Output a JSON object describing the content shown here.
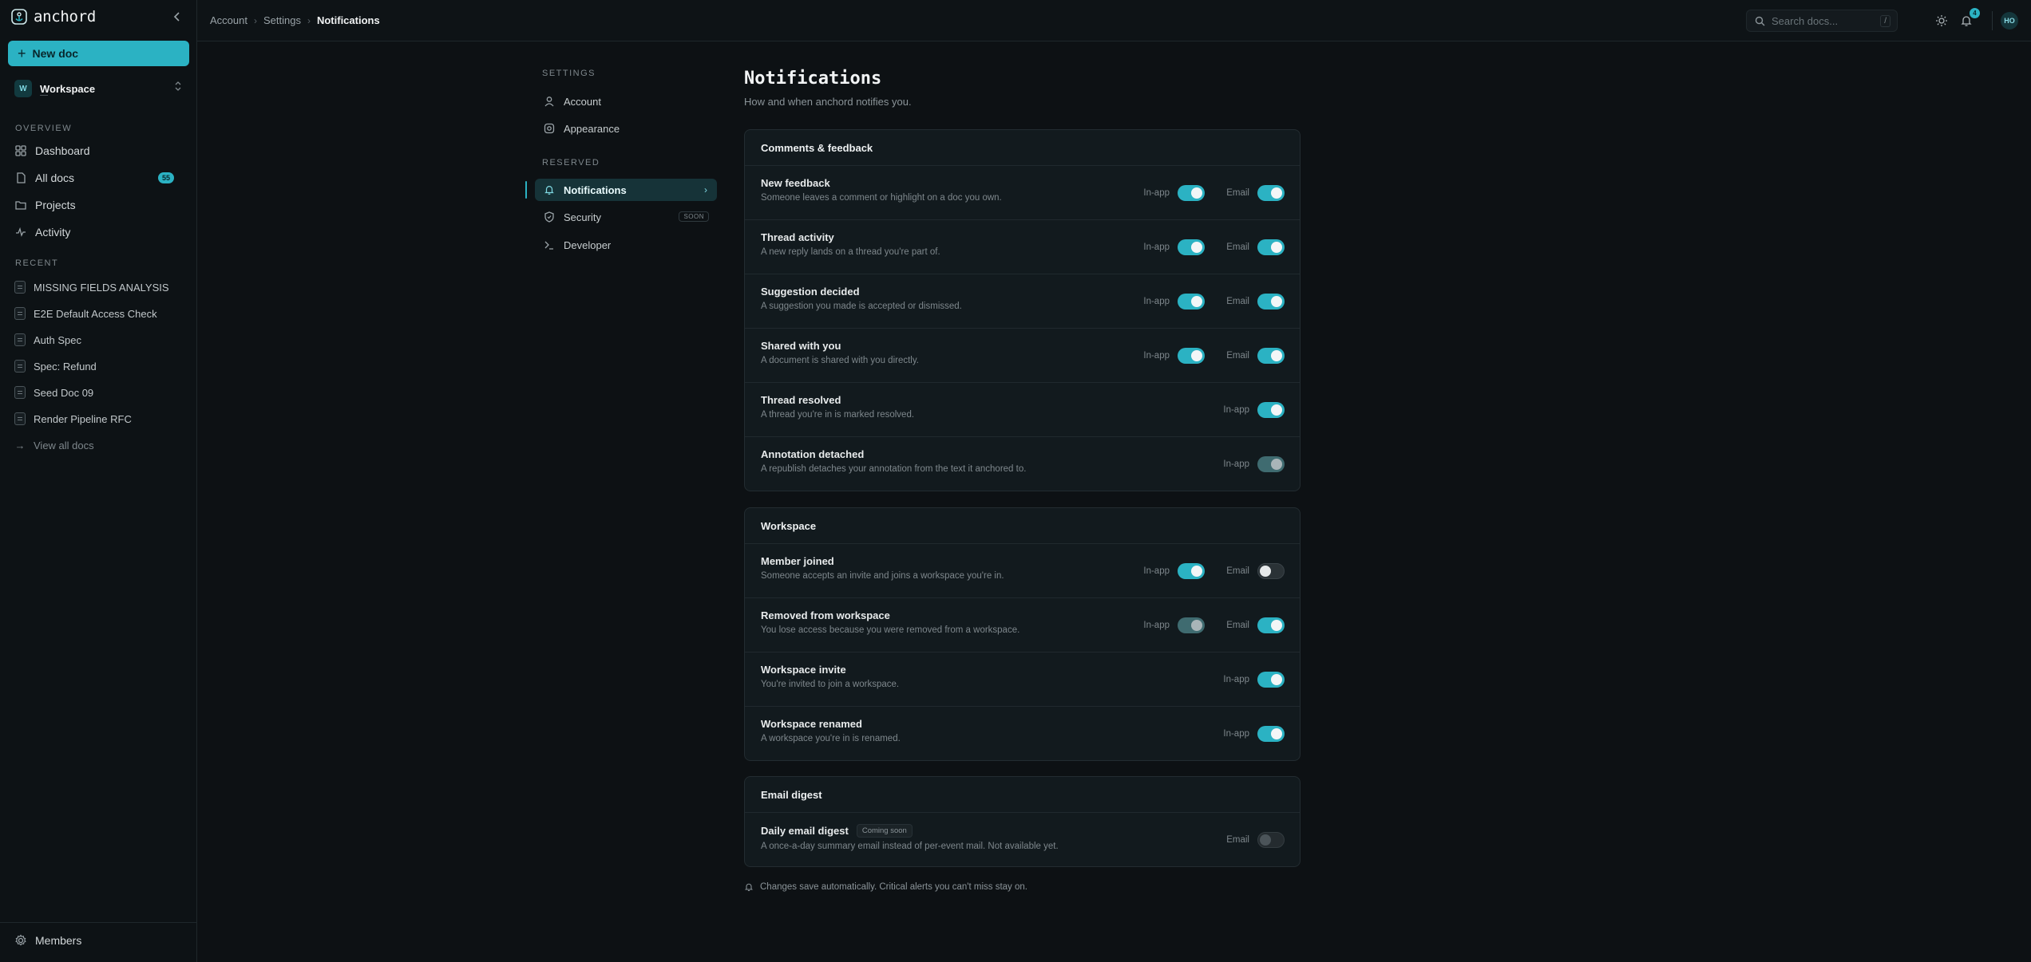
{
  "sidebar": {
    "brand": "anchord",
    "new_doc_label": "New doc",
    "workspace": {
      "initial": "W",
      "name": "Workspace",
      "sub": "—"
    },
    "overview_label": "OVERVIEW",
    "nav": [
      {
        "label": "Dashboard",
        "icon": "grid-icon"
      },
      {
        "label": "All docs",
        "icon": "file-icon",
        "count": "55"
      },
      {
        "label": "Projects",
        "icon": "folder-icon"
      },
      {
        "label": "Activity",
        "icon": "activity-icon"
      }
    ],
    "recent_label": "RECENT",
    "recent": [
      {
        "label": "MISSING FIELDS ANALYSIS"
      },
      {
        "label": "E2E Default Access Check"
      },
      {
        "label": "Auth Spec"
      },
      {
        "label": "Spec: Refund"
      },
      {
        "label": "Seed Doc 09"
      },
      {
        "label": "Render Pipeline RFC"
      }
    ],
    "view_all": "View all docs",
    "members": "Members"
  },
  "topbar": {
    "breadcrumb": [
      "Account",
      "Settings",
      "Notifications"
    ],
    "search_placeholder": "Search docs...",
    "search_shortcut": "/",
    "notification_count": "4",
    "avatar_initials": "HO"
  },
  "settings_nav": {
    "settings_label": "SETTINGS",
    "reserved_label": "RESERVED",
    "account": "Account",
    "appearance": "Appearance",
    "notifications": "Notifications",
    "security": "Security",
    "security_badge": "SOON",
    "developer": "Developer"
  },
  "page": {
    "title": "Notifications",
    "subtitle": "How and when anchord notifies you.",
    "footnote": "Changes save automatically. Critical alerts you can't miss stay on."
  },
  "labels": {
    "in_app": "In-app",
    "email": "Email"
  },
  "sections": [
    {
      "title": "Comments & feedback",
      "rows": [
        {
          "title": "New feedback",
          "desc": "Someone leaves a comment or highlight on a doc you own.",
          "in_app": "on",
          "email": "on"
        },
        {
          "title": "Thread activity",
          "desc": "A new reply lands on a thread you're part of.",
          "in_app": "on",
          "email": "on"
        },
        {
          "title": "Suggestion decided",
          "desc": "A suggestion you made is accepted or dismissed.",
          "in_app": "on",
          "email": "on"
        },
        {
          "title": "Shared with you",
          "desc": "A document is shared with you directly.",
          "in_app": "on",
          "email": "on"
        },
        {
          "title": "Thread resolved",
          "desc": "A thread you're in is marked resolved.",
          "in_app": "on"
        },
        {
          "title": "Annotation detached",
          "desc": "A republish detaches your annotation from the text it anchored to.",
          "in_app": "locked"
        }
      ]
    },
    {
      "title": "Workspace",
      "rows": [
        {
          "title": "Member joined",
          "desc": "Someone accepts an invite and joins a workspace you're in.",
          "in_app": "on",
          "email": "off"
        },
        {
          "title": "Removed from workspace",
          "desc": "You lose access because you were removed from a workspace.",
          "in_app": "locked",
          "email": "on"
        },
        {
          "title": "Workspace invite",
          "desc": "You're invited to join a workspace.",
          "in_app": "on"
        },
        {
          "title": "Workspace renamed",
          "desc": "A workspace you're in is renamed.",
          "in_app": "on"
        }
      ]
    },
    {
      "title": "Email digest",
      "rows": [
        {
          "title": "Daily email digest",
          "badge": "Coming soon",
          "desc": "A once-a-day summary email instead of per-event mail. Not available yet.",
          "email": "disabled"
        }
      ]
    }
  ],
  "colors": {
    "accent": "#2bb2c3",
    "background": "#0d1114",
    "card": "#121a1e"
  }
}
